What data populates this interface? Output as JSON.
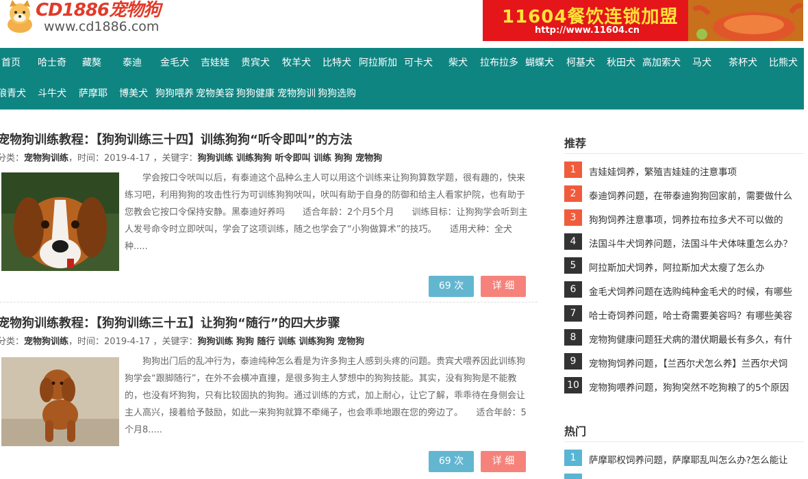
{
  "header": {
    "logo_title": "CD1886宠物狗",
    "logo_url": "www.cd1886.com",
    "banner_title": "11604餐饮连锁加盟",
    "banner_url": "http://www.11604.cn"
  },
  "nav": {
    "row1": [
      "首页",
      "哈士奇",
      "藏獒",
      "泰迪",
      "金毛犬",
      "吉娃娃",
      "贵宾犬",
      "牧羊犬",
      "比特犬",
      "阿拉斯加",
      "可卡犬",
      "柴犬",
      "拉布拉多",
      "蝴蝶犬",
      "柯基犬",
      "秋田犬",
      "高加索犬",
      "马犬",
      "茶杯犬",
      "比熊犬"
    ],
    "row2": [
      "狼青犬",
      "斗牛犬",
      "萨摩耶",
      "博美犬",
      "狗狗喂养",
      "宠物美容",
      "狗狗健康",
      "宠物狗训",
      "狗狗选购"
    ]
  },
  "articles": [
    {
      "title": "宠物狗训练教程：【狗狗训练三十四】训练狗狗“听令即叫”的方法",
      "meta_category_label": "分类：",
      "meta_category": "宠物狗训练",
      "meta_time": "，时间：2019-4-17 ，关键字：",
      "meta_keywords": "狗狗训练 训练狗狗 听令即叫 训练 狗狗 宠物狗",
      "desc": "学会按口令吠叫以后，有泰迪这个品种么主人可以用这个训练来让狗狗算数学题，很有趣的，快来练习吧，利用狗狗的攻击性行为可训练狗狗吠叫，吠叫有助于自身的防御和给主人看家护院，也有助于您教会它按口令保持安静。黑泰迪好养吗　　适合年龄：2个月5个月　　训练目标：让狗狗学会听到主人发号命令时立即吠叫，学会了这项训练，随之也学会了“小狗做算术”的技巧。　　适用犬种：全犬种.....",
      "views": "69 次",
      "detail": "详 细"
    },
    {
      "title": "宠物狗训练教程：【狗狗训练三十五】让狗狗“随行”的四大步骤",
      "meta_category_label": "分类：",
      "meta_category": "宠物狗训练",
      "meta_time": "，时间：2019-4-17 ，关键字：",
      "meta_keywords": "狗狗训练 狗狗 随行 训练 训练狗狗 宠物狗",
      "desc": "狗狗出门后的乱冲行为，泰迪纯种怎么看是为许多狗主人感到头疼的问题。贵宾犬喂养因此训练狗狗学会“跟脚随行”，在外不会横冲直撞，是很多狗主人梦想中的狗狗技能。其实，没有狗狗是不能教的，也没有坏狗狗，只有比较固执的狗狗。通过训练的方式，加上耐心，让它了解，乖乖待在身侧会让主人高兴，接着给予鼓励，如此一来狗狗就算不牵绳子，也会乖乖地跟在您的旁边了。　　适合年龄：5个月8.....",
      "views": "69 次",
      "detail": "详 细"
    }
  ],
  "sidebar": {
    "recommend_heading": "推荐",
    "recommend": [
      {
        "num": "1",
        "text": "吉娃娃饲养，繁殖吉娃娃的注意事项"
      },
      {
        "num": "2",
        "text": "泰迪饲养问题，在带泰迪狗狗回家前，需要做什么"
      },
      {
        "num": "3",
        "text": "狗狗饲养注意事项，饲养拉布拉多犬不可以做的"
      },
      {
        "num": "4",
        "text": "法国斗牛犬饲养问题，法国斗牛犬体味重怎么办？"
      },
      {
        "num": "5",
        "text": "阿拉斯加犬饲养，阿拉斯加犬太瘦了怎么办"
      },
      {
        "num": "6",
        "text": "金毛犬饲养问题在选购纯种金毛犬的时候，有哪些"
      },
      {
        "num": "7",
        "text": "哈士奇饲养问题，哈士奇需要美容吗？有哪些美容"
      },
      {
        "num": "8",
        "text": "宠物狗健康问题狂犬病的潜伏期最长有多久，有什"
      },
      {
        "num": "9",
        "text": "宠物狗饲养问题，【兰西尔犬怎么养】兰西尔犬饲"
      },
      {
        "num": "10",
        "text": "宠物狗喂养问题，狗狗突然不吃狗粮了的5个原因"
      }
    ],
    "hot_heading": "热门",
    "hot": [
      {
        "num": "1",
        "text": "萨摩耶权饲养问题，萨摩耶乱叫怎么办?怎么能让"
      }
    ]
  },
  "colors": {
    "nav_bg": "#0f8582",
    "views_btn": "#63b6d0",
    "detail_btn": "#f5837b",
    "rank_top": "#f05b3c",
    "rank_default": "#333333"
  }
}
